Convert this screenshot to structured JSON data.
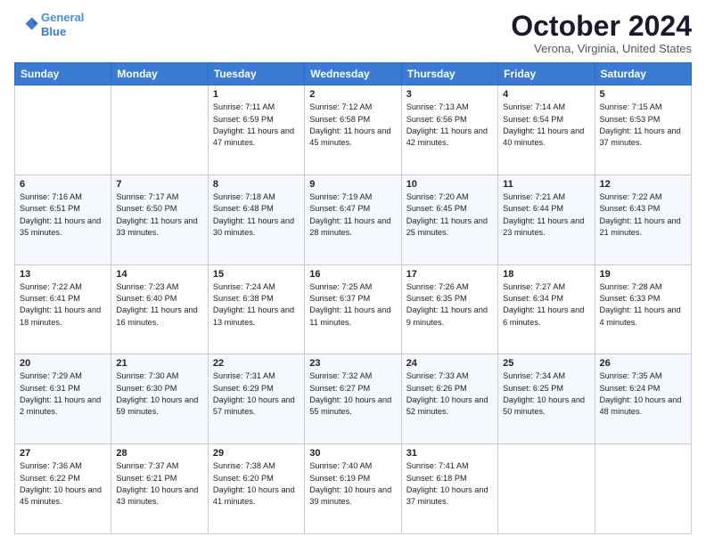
{
  "header": {
    "logo_line1": "General",
    "logo_line2": "Blue",
    "month_title": "October 2024",
    "location": "Verona, Virginia, United States"
  },
  "days_of_week": [
    "Sunday",
    "Monday",
    "Tuesday",
    "Wednesday",
    "Thursday",
    "Friday",
    "Saturday"
  ],
  "weeks": [
    [
      {
        "day": "",
        "info": ""
      },
      {
        "day": "",
        "info": ""
      },
      {
        "day": "1",
        "info": "Sunrise: 7:11 AM\nSunset: 6:59 PM\nDaylight: 11 hours and 47 minutes."
      },
      {
        "day": "2",
        "info": "Sunrise: 7:12 AM\nSunset: 6:58 PM\nDaylight: 11 hours and 45 minutes."
      },
      {
        "day": "3",
        "info": "Sunrise: 7:13 AM\nSunset: 6:56 PM\nDaylight: 11 hours and 42 minutes."
      },
      {
        "day": "4",
        "info": "Sunrise: 7:14 AM\nSunset: 6:54 PM\nDaylight: 11 hours and 40 minutes."
      },
      {
        "day": "5",
        "info": "Sunrise: 7:15 AM\nSunset: 6:53 PM\nDaylight: 11 hours and 37 minutes."
      }
    ],
    [
      {
        "day": "6",
        "info": "Sunrise: 7:16 AM\nSunset: 6:51 PM\nDaylight: 11 hours and 35 minutes."
      },
      {
        "day": "7",
        "info": "Sunrise: 7:17 AM\nSunset: 6:50 PM\nDaylight: 11 hours and 33 minutes."
      },
      {
        "day": "8",
        "info": "Sunrise: 7:18 AM\nSunset: 6:48 PM\nDaylight: 11 hours and 30 minutes."
      },
      {
        "day": "9",
        "info": "Sunrise: 7:19 AM\nSunset: 6:47 PM\nDaylight: 11 hours and 28 minutes."
      },
      {
        "day": "10",
        "info": "Sunrise: 7:20 AM\nSunset: 6:45 PM\nDaylight: 11 hours and 25 minutes."
      },
      {
        "day": "11",
        "info": "Sunrise: 7:21 AM\nSunset: 6:44 PM\nDaylight: 11 hours and 23 minutes."
      },
      {
        "day": "12",
        "info": "Sunrise: 7:22 AM\nSunset: 6:43 PM\nDaylight: 11 hours and 21 minutes."
      }
    ],
    [
      {
        "day": "13",
        "info": "Sunrise: 7:22 AM\nSunset: 6:41 PM\nDaylight: 11 hours and 18 minutes."
      },
      {
        "day": "14",
        "info": "Sunrise: 7:23 AM\nSunset: 6:40 PM\nDaylight: 11 hours and 16 minutes."
      },
      {
        "day": "15",
        "info": "Sunrise: 7:24 AM\nSunset: 6:38 PM\nDaylight: 11 hours and 13 minutes."
      },
      {
        "day": "16",
        "info": "Sunrise: 7:25 AM\nSunset: 6:37 PM\nDaylight: 11 hours and 11 minutes."
      },
      {
        "day": "17",
        "info": "Sunrise: 7:26 AM\nSunset: 6:35 PM\nDaylight: 11 hours and 9 minutes."
      },
      {
        "day": "18",
        "info": "Sunrise: 7:27 AM\nSunset: 6:34 PM\nDaylight: 11 hours and 6 minutes."
      },
      {
        "day": "19",
        "info": "Sunrise: 7:28 AM\nSunset: 6:33 PM\nDaylight: 11 hours and 4 minutes."
      }
    ],
    [
      {
        "day": "20",
        "info": "Sunrise: 7:29 AM\nSunset: 6:31 PM\nDaylight: 11 hours and 2 minutes."
      },
      {
        "day": "21",
        "info": "Sunrise: 7:30 AM\nSunset: 6:30 PM\nDaylight: 10 hours and 59 minutes."
      },
      {
        "day": "22",
        "info": "Sunrise: 7:31 AM\nSunset: 6:29 PM\nDaylight: 10 hours and 57 minutes."
      },
      {
        "day": "23",
        "info": "Sunrise: 7:32 AM\nSunset: 6:27 PM\nDaylight: 10 hours and 55 minutes."
      },
      {
        "day": "24",
        "info": "Sunrise: 7:33 AM\nSunset: 6:26 PM\nDaylight: 10 hours and 52 minutes."
      },
      {
        "day": "25",
        "info": "Sunrise: 7:34 AM\nSunset: 6:25 PM\nDaylight: 10 hours and 50 minutes."
      },
      {
        "day": "26",
        "info": "Sunrise: 7:35 AM\nSunset: 6:24 PM\nDaylight: 10 hours and 48 minutes."
      }
    ],
    [
      {
        "day": "27",
        "info": "Sunrise: 7:36 AM\nSunset: 6:22 PM\nDaylight: 10 hours and 45 minutes."
      },
      {
        "day": "28",
        "info": "Sunrise: 7:37 AM\nSunset: 6:21 PM\nDaylight: 10 hours and 43 minutes."
      },
      {
        "day": "29",
        "info": "Sunrise: 7:38 AM\nSunset: 6:20 PM\nDaylight: 10 hours and 41 minutes."
      },
      {
        "day": "30",
        "info": "Sunrise: 7:40 AM\nSunset: 6:19 PM\nDaylight: 10 hours and 39 minutes."
      },
      {
        "day": "31",
        "info": "Sunrise: 7:41 AM\nSunset: 6:18 PM\nDaylight: 10 hours and 37 minutes."
      },
      {
        "day": "",
        "info": ""
      },
      {
        "day": "",
        "info": ""
      }
    ]
  ]
}
